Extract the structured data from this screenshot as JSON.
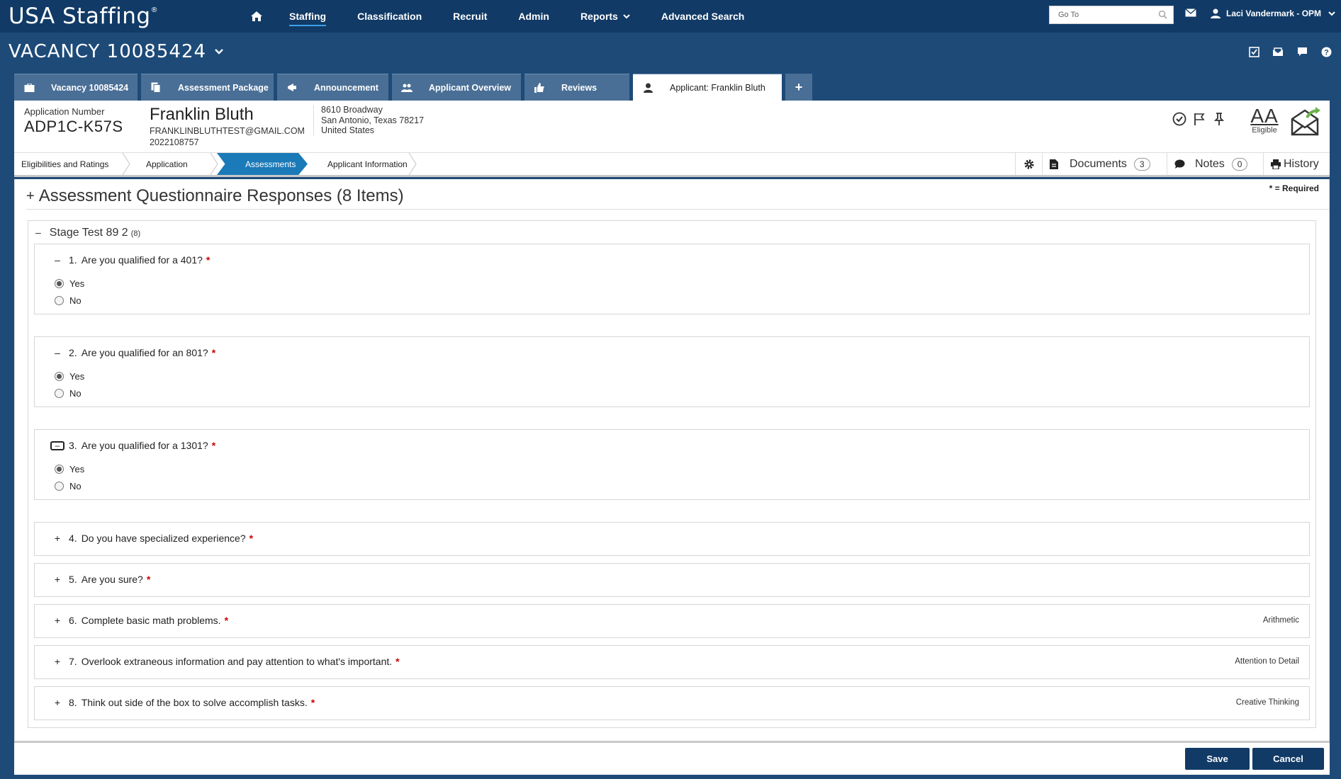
{
  "app": {
    "brand": "USA Staffing",
    "brand_mark": "®"
  },
  "nav": {
    "items": [
      {
        "label": "Staffing"
      },
      {
        "label": "Classification"
      },
      {
        "label": "Recruit"
      },
      {
        "label": "Admin"
      },
      {
        "label": "Reports"
      },
      {
        "label": "Advanced Search"
      }
    ],
    "active": "Staffing",
    "goto_placeholder": "Go To",
    "user": "Laci Vandermark - OPM"
  },
  "vacancy": {
    "title": "VACANCY 10085424"
  },
  "tabs": [
    {
      "label": "Vacancy 10085424"
    },
    {
      "label": "Assessment Package"
    },
    {
      "label": "Announcement"
    },
    {
      "label": "Applicant Overview"
    },
    {
      "label": "Reviews"
    },
    {
      "label": "Applicant: Franklin Bluth"
    }
  ],
  "applicant": {
    "number_label": "Application Number",
    "number": "ADP1C-K57S",
    "name": "Franklin Bluth",
    "email": "FRANKLINBLUTHTEST@GMAIL.COM",
    "phone": "2022108757",
    "address_line1": "8610 Broadway",
    "address_line2": "San Antonio, Texas 78217",
    "address_line3": "United States",
    "eligibility_code": "AA",
    "eligibility_label": "Eligible"
  },
  "steps": [
    {
      "label": "Eligibilities and Ratings"
    },
    {
      "label": "Application"
    },
    {
      "label": "Assessments"
    },
    {
      "label": "Applicant Information"
    }
  ],
  "tools": {
    "documents_label": "Documents",
    "documents_count": "3",
    "notes_label": "Notes",
    "notes_count": "0",
    "history_label": "History"
  },
  "section": {
    "title": "Assessment Questionnaire Responses (8 Items)",
    "required_note": "* = Required",
    "stage_title": "Stage Test 89 2",
    "stage_count": "(8)"
  },
  "questions": [
    {
      "num": "1.",
      "text": "Are you qualified for a 401?",
      "expanded": true,
      "options": [
        "Yes",
        "No"
      ],
      "selected": "Yes",
      "category": ""
    },
    {
      "num": "2.",
      "text": "Are you qualified for an 801?",
      "expanded": true,
      "options": [
        "Yes",
        "No"
      ],
      "selected": "Yes",
      "category": ""
    },
    {
      "num": "3.",
      "text": "Are you qualified for a 1301?",
      "expanded": true,
      "options": [
        "Yes",
        "No"
      ],
      "selected": "Yes",
      "category": ""
    },
    {
      "num": "4.",
      "text": "Do you have specialized experience?",
      "expanded": false,
      "category": ""
    },
    {
      "num": "5.",
      "text": "Are you sure?",
      "expanded": false,
      "category": ""
    },
    {
      "num": "6.",
      "text": "Complete basic math problems.",
      "expanded": false,
      "category": "Arithmetic"
    },
    {
      "num": "7.",
      "text": "Overlook extraneous information and pay attention to what's important.",
      "expanded": false,
      "category": "Attention to Detail"
    },
    {
      "num": "8.",
      "text": "Think out side of the box to solve accomplish tasks.",
      "expanded": false,
      "category": "Creative Thinking"
    }
  ],
  "symbols": {
    "minus": "–",
    "plus": "+",
    "required_star": "*",
    "chevron": "⌄"
  },
  "footer": {
    "save_label": "Save",
    "cancel_label": "Cancel"
  },
  "colors": {
    "header_dark": "#113a66",
    "header": "#1e4a78",
    "tab": "#4a6f96",
    "step_active": "#1b7ab8",
    "required": "#cc0000"
  }
}
